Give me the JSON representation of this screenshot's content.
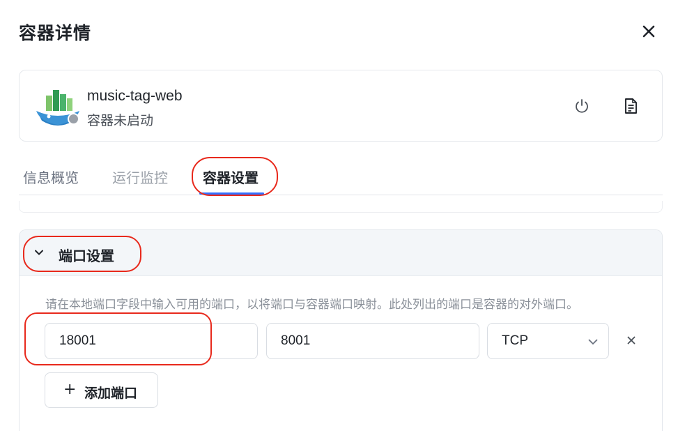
{
  "dialog": {
    "title": "容器详情"
  },
  "container": {
    "name": "music-tag-web",
    "status_text": "容器未启动",
    "status_color": "#9aa0a8"
  },
  "icons": {
    "close": "close-icon",
    "power": "power-icon",
    "log": "document-icon",
    "expand": "chevron-down-icon",
    "remove": "remove-icon",
    "add": "plus-icon"
  },
  "tabs": [
    {
      "label": "信息概览",
      "active": false
    },
    {
      "label": "运行监控",
      "active": false
    },
    {
      "label": "容器设置",
      "active": true
    }
  ],
  "port_section": {
    "title": "端口设置",
    "hint": "请在本地端口字段中输入可用的端口，以将端口与容器端口映射。此处列出的端口是容器的对外端口。",
    "mapping": {
      "local_port": "18001",
      "container_port": "8001",
      "protocol": "TCP"
    },
    "add_label": "添加端口"
  },
  "colors": {
    "accent": "#3370ff",
    "annotation_red": "#e8291c",
    "header_bg": "#f3f6f9"
  }
}
